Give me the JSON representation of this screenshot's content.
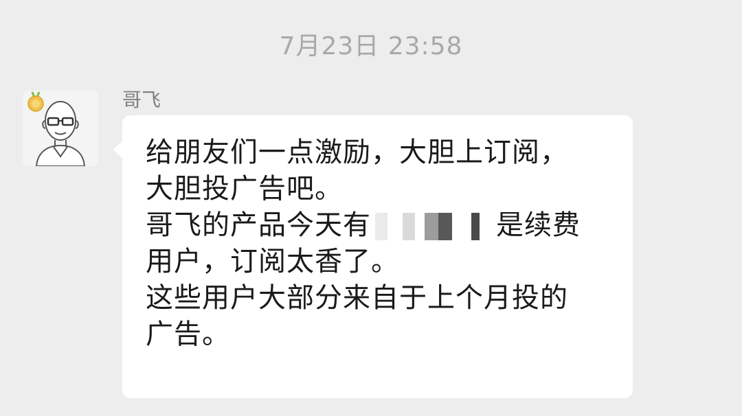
{
  "timestamp": "7月23日 23:58",
  "sender": {
    "name": "哥飞",
    "avatar_icon": "bald-man-with-glasses-avatar-icon",
    "badge_icon": "gold-medal-badge-icon"
  },
  "message": {
    "line1": "给朋友们一点激励，大胆上订阅，",
    "line2": "大胆投广告吧。",
    "line3_before": "哥飞的产品今天有",
    "line3_after": "是续费",
    "line4": "用户，订阅太香了。",
    "line5": "这些用户大部分来自于上个月投的",
    "line6": "广告。"
  },
  "colors": {
    "background": "#ededed",
    "bubble": "#ffffff",
    "timestamp_text": "#a8a8a8",
    "name_text": "#808080",
    "message_text": "#1a1a1a"
  }
}
